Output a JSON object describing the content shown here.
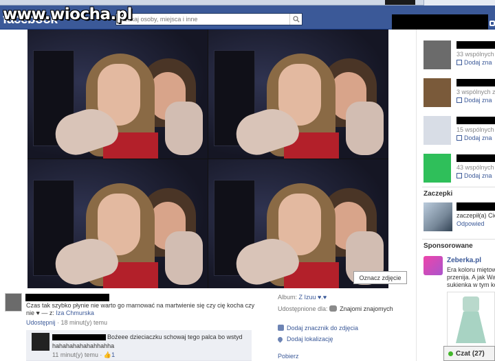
{
  "watermark": "www.wiocha.pl",
  "topbar": {
    "logo": "facebook",
    "search_placeholder": "Szukaj osoby, miejsca i inne"
  },
  "photo": {
    "tag_button": "Oznacz zdjęcie"
  },
  "post": {
    "caption": "Czas tak szybko płynie nie warto go marnować na martwienie się czy cię kocha czy nie ♥ — z: ",
    "tagged": "Iza Chmurska",
    "share": "Udostępnij",
    "time": " · 18 minut(y) temu"
  },
  "comment": {
    "text_line1": "Boźeee dzieciaczku schowaj tego palca bo wstyd",
    "text_line2": "hahahahahahahhahha",
    "time": "11 minut(y) temu · ",
    "likes": "1"
  },
  "info": {
    "album_label": "Album:",
    "album_value": "Z Izuu ♥.♥",
    "shared_label": "Udostępnione dla:",
    "shared_value": "Znajomi znajomych",
    "add_tag": "Dodaj znacznik do zdjęcia",
    "add_location": "Dodaj lokalizację",
    "download": "Pobierz"
  },
  "suggestions": [
    {
      "mutual": "33 wspólnych",
      "add": "Dodaj zna",
      "color": "#6b6b6b"
    },
    {
      "mutual": "3 wspólnych zn",
      "add": "Dodaj zna",
      "color": "#7a5a3a"
    },
    {
      "mutual": "15 wspólnych",
      "add": "Dodaj zna",
      "color": "#d8dde6"
    },
    {
      "mutual": "43 wspólnych",
      "add": "Dodaj zna",
      "color": "#2fbf5a"
    }
  ],
  "pokes": {
    "title": "Zaczepki",
    "text": "zaczepił(a) Cię",
    "reply": "Odpowied"
  },
  "sponsored": {
    "title": "Sponsorowane",
    "ad_title": "Zeberka.pl",
    "ad_line1": "Era koloru miętowe",
    "ad_line2": "przenija. A jak Wa",
    "ad_line3": "sukienka w tym ko"
  },
  "chat": {
    "label": "Czat (27)"
  }
}
